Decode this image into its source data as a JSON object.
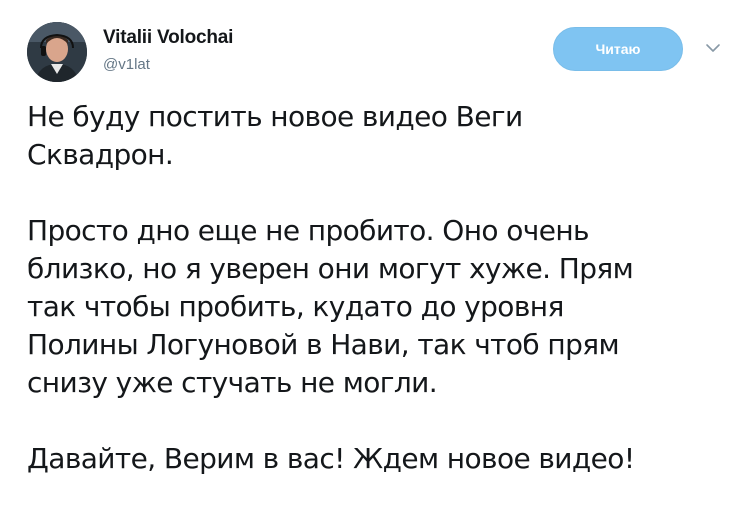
{
  "user": {
    "display_name": "Vitalii Volochai",
    "handle": "@v1lat",
    "avatar_icon": "profile-photo"
  },
  "actions": {
    "follow_label": "Читаю",
    "menu_icon": "chevron-down-icon"
  },
  "colors": {
    "follow_button_bg": "#7fc4f2",
    "handle_text": "#657786",
    "body_text": "#14171a"
  },
  "tweet": {
    "paragraphs": [
      {
        "lines": [
          "Не буду постить новое видео Веги",
          "Сквадрон."
        ]
      },
      {
        "lines": [
          "Просто дно еще не пробито. Оно очень",
          "близко, но я уверен они могут хуже. Прям",
          "так чтобы пробить, кудато до уровня",
          "Полины Логуновой в Нави, так чтоб прям",
          "снизу уже стучать не могли."
        ]
      },
      {
        "lines": [
          "Давайте, Верим в вас! Ждем новое видео!"
        ]
      }
    ]
  }
}
